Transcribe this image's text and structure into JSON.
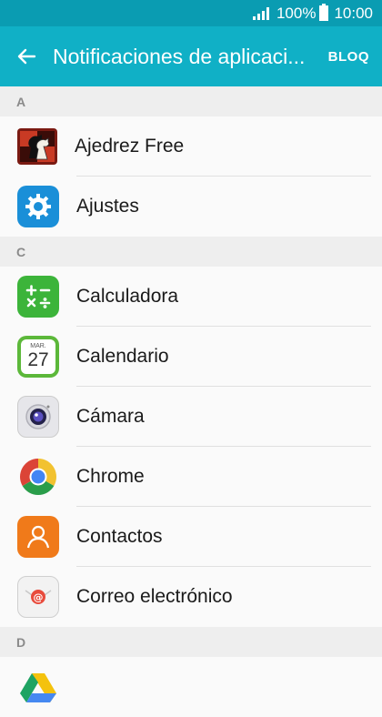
{
  "status_bar": {
    "battery": "100%",
    "time": "10:00"
  },
  "app_bar": {
    "title": "Notificaciones de aplicaci...",
    "action": "BLOQ"
  },
  "sections": [
    {
      "letter": "A",
      "apps": [
        "Ajedrez Free",
        "Ajustes"
      ]
    },
    {
      "letter": "C",
      "apps": [
        "Calculadora",
        "Calendario",
        "Cámara",
        "Chrome",
        "Contactos",
        "Correo electrónico"
      ]
    },
    {
      "letter": "D",
      "apps": []
    }
  ],
  "calendar_icon": {
    "month": "MAR.",
    "day": "27"
  },
  "icons": [
    "chess-icon",
    "settings-gear-icon",
    "calculator-icon",
    "calendar-icon",
    "camera-icon",
    "chrome-icon",
    "contacts-icon",
    "email-icon",
    "drive-icon"
  ]
}
